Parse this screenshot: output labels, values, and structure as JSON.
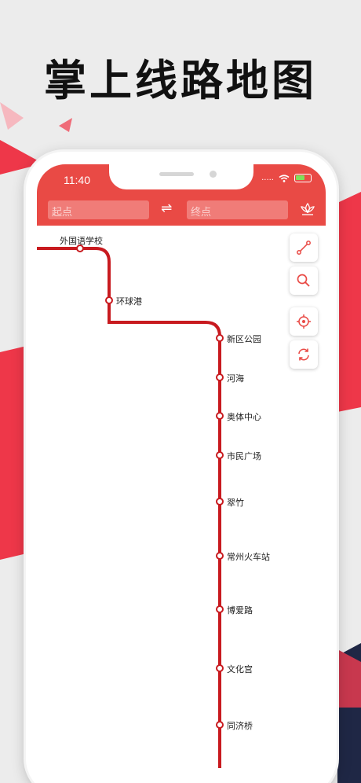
{
  "headline": "掌上线路地图",
  "status": {
    "time": "11:40",
    "signal": "....."
  },
  "route": {
    "start_placeholder": "起点",
    "end_placeholder": "终点",
    "swap_symbol": "⇌"
  },
  "tools": [
    "route-tool-icon",
    "search-icon",
    "locate-icon",
    "refresh-icon"
  ],
  "line_color": "#c81a1f",
  "accent": "#e94a45",
  "stations": [
    "外国语学校",
    "环球港",
    "新区公园",
    "河海",
    "奥体中心",
    "市民广场",
    "翠竹",
    "常州火车站",
    "博爱路",
    "文化宫",
    "同济桥"
  ]
}
